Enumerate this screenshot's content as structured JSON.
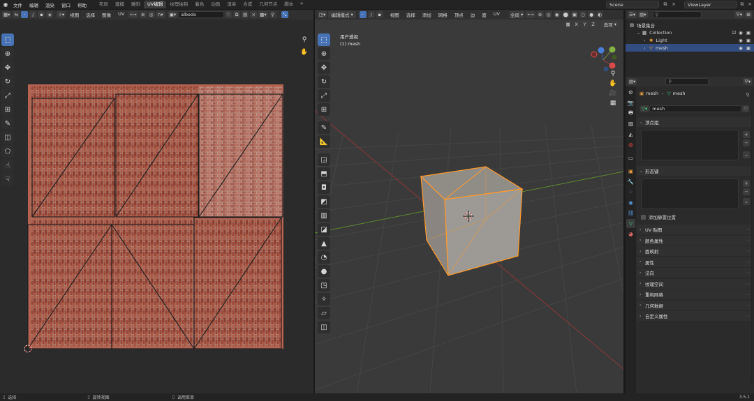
{
  "topbar": {
    "menus": [
      "文件",
      "编辑",
      "渲染",
      "窗口",
      "帮助"
    ],
    "workspaces": [
      "布局",
      "建模",
      "雕刻",
      "UV编辑",
      "纹理绘制",
      "着色",
      "动画",
      "渲染",
      "合成",
      "几何节点",
      "脚本"
    ],
    "active_workspace": "UV编辑",
    "add_workspace": "+",
    "scene": "Scene",
    "view_layer": "ViewLayer"
  },
  "uv_editor": {
    "menus": [
      "视图",
      "选择",
      "图像",
      "UV"
    ],
    "image_name": "albedo",
    "tools": [
      {
        "name": "select-box-tool",
        "icon": "⬚",
        "active": true
      },
      {
        "name": "cursor-tool",
        "icon": "⊕"
      },
      {
        "name": "move-tool",
        "icon": "✥"
      },
      {
        "name": "rotate-tool",
        "icon": "↻"
      },
      {
        "name": "scale-tool",
        "icon": "⤢"
      },
      {
        "name": "transform-tool",
        "icon": "⊞"
      },
      {
        "name": "annotate-tool",
        "icon": "✎"
      },
      {
        "name": "rip-tool",
        "icon": "◫"
      },
      {
        "name": "grab-tool",
        "icon": "⬠"
      },
      {
        "name": "relax-tool",
        "icon": "☝"
      },
      {
        "name": "pinch-tool",
        "icon": "☟"
      }
    ]
  },
  "viewport": {
    "mode": "编辑模式",
    "menus": [
      "视图",
      "选择",
      "添加",
      "网格",
      "顶点",
      "边",
      "面",
      "UV"
    ],
    "transform_orientation": "全局",
    "overlay_label": "选项",
    "axis_labels": [
      "X",
      "Y",
      "Z"
    ],
    "view_name": "用户透视",
    "object_info": "(1) mesh",
    "tools": [
      {
        "name": "select-box-tool",
        "icon": "⬚",
        "active": true
      },
      {
        "name": "cursor-tool",
        "icon": "⊕"
      },
      {
        "name": "move-tool",
        "icon": "✥"
      },
      {
        "name": "rotate-tool",
        "icon": "↻"
      },
      {
        "name": "scale-tool",
        "icon": "⤢"
      },
      {
        "name": "transform-tool",
        "icon": "⊞"
      },
      {
        "name": "annotate-tool",
        "icon": "✎",
        "gap": true
      },
      {
        "name": "measure-tool",
        "icon": "📐"
      },
      {
        "name": "add-cube-tool",
        "icon": "◲",
        "gap": true
      },
      {
        "name": "extrude-tool",
        "icon": "⬒"
      },
      {
        "name": "inset-tool",
        "icon": "◘"
      },
      {
        "name": "bevel-tool",
        "icon": "◩"
      },
      {
        "name": "loop-cut-tool",
        "icon": "▥"
      },
      {
        "name": "knife-tool",
        "icon": "◪"
      },
      {
        "name": "poly-build-tool",
        "icon": "▲"
      },
      {
        "name": "spin-tool",
        "icon": "◔"
      },
      {
        "name": "smooth-tool",
        "icon": "●"
      },
      {
        "name": "edge-slide-tool",
        "icon": "◳"
      },
      {
        "name": "shrink-tool",
        "icon": "✧"
      },
      {
        "name": "shear-tool",
        "icon": "▱"
      },
      {
        "name": "rip-region-tool",
        "icon": "◫"
      }
    ]
  },
  "outliner": {
    "search_placeholder": "",
    "rows": [
      {
        "name": "outliner-scene-collection",
        "label": "场景集合",
        "indent": 0,
        "icon": "▤"
      },
      {
        "name": "outliner-collection",
        "label": "Collection",
        "indent": 1,
        "icon": "▦"
      },
      {
        "name": "outliner-light",
        "label": "Light",
        "indent": 2,
        "icon": "✺"
      },
      {
        "name": "outliner-mesh",
        "label": "mesh",
        "indent": 2,
        "icon": "▽",
        "selected": true
      }
    ]
  },
  "properties": {
    "breadcrumb": [
      "mesh",
      "mesh"
    ],
    "data_name": "mesh",
    "panels_open": [
      "顶点组",
      "形态键"
    ],
    "checkbox_label": "添加静置位置",
    "panels_closed": [
      "UV 贴图",
      "颜色属性",
      "面映射",
      "属性",
      "法向",
      "纹理空间",
      "重构网格",
      "几何数据",
      "自定义属性"
    ]
  },
  "statusbar": {
    "items": [
      "选择",
      "旋转视图",
      "调用菜单"
    ],
    "version": "3.5.1"
  }
}
